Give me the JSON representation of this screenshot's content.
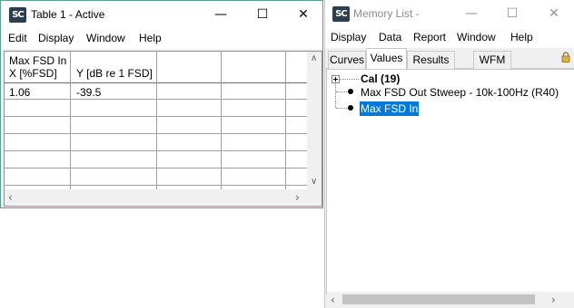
{
  "table_window": {
    "title": "Table 1 - Active",
    "app_icon_text": "SC",
    "menu": [
      "Edit",
      "Display",
      "Window",
      "Help"
    ],
    "columns": [
      {
        "line1": "Max FSD In",
        "line2": "X [%FSD]"
      },
      {
        "line1": "",
        "line2": "Y [dB re 1 FSD]"
      }
    ],
    "rows": [
      {
        "x": "1.06",
        "y": "-39.5"
      }
    ]
  },
  "memory_window": {
    "title": "Memory List -",
    "app_icon_text": "SC",
    "menu": [
      "Display",
      "Data",
      "Report",
      "Window",
      "Help"
    ],
    "tabs": [
      "Curves",
      "Values",
      "Results",
      "WFM"
    ],
    "active_tab": "Values",
    "tree": {
      "root_label": "Cal (19)",
      "children": [
        {
          "label": "Max FSD Out Stweep - 10k-100Hz (R40)",
          "selected": false
        },
        {
          "label": "Max FSD In",
          "selected": true
        }
      ]
    }
  },
  "colors": {
    "selection": "#0078d7",
    "accent_border": "#2e8b7a",
    "icon_bg": "#2c3e50"
  }
}
